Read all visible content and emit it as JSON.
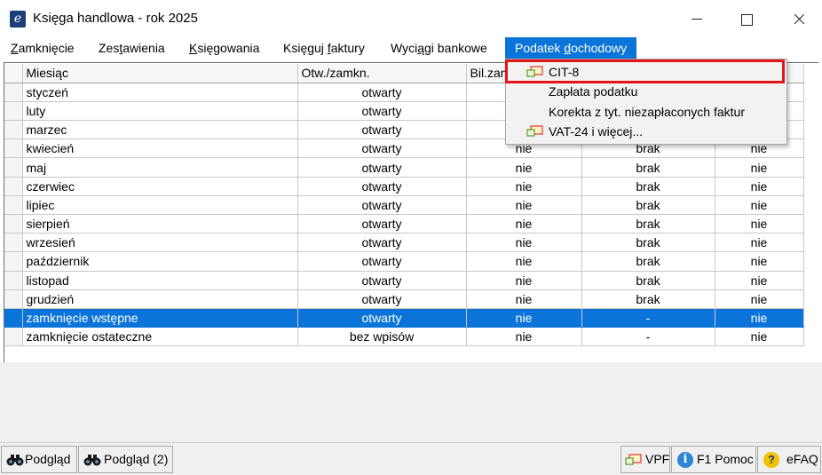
{
  "window": {
    "icon_letter": "e",
    "title": "Księga handlowa - rok 2025"
  },
  "menubar": {
    "items": [
      {
        "label": "Zamknięcie",
        "accel": "Z"
      },
      {
        "label": "Zestawienia",
        "accel": "t"
      },
      {
        "label": "Księgowania",
        "accel": "K"
      },
      {
        "label": "Księguj faktury",
        "accel": "f"
      },
      {
        "label": "Wyciągi bankowe",
        "accel": "ą"
      },
      {
        "label": "Podatek dochodowy",
        "accel": "d",
        "active": true
      }
    ]
  },
  "grid": {
    "columns": [
      "Miesiąc",
      "Otw./zamkn.",
      "Bil.zam",
      "",
      ""
    ],
    "rows": [
      {
        "month": "styczeń",
        "state": "otwarty",
        "c3": "",
        "c4": "",
        "c5": ""
      },
      {
        "month": "luty",
        "state": "otwarty",
        "c3": "",
        "c4": "",
        "c5": ""
      },
      {
        "month": "marzec",
        "state": "otwarty",
        "c3": "",
        "c4": "",
        "c5": ""
      },
      {
        "month": "kwiecień",
        "state": "otwarty",
        "c3": "nie",
        "c4": "brak",
        "c5": "nie"
      },
      {
        "month": "maj",
        "state": "otwarty",
        "c3": "nie",
        "c4": "brak",
        "c5": "nie"
      },
      {
        "month": "czerwiec",
        "state": "otwarty",
        "c3": "nie",
        "c4": "brak",
        "c5": "nie"
      },
      {
        "month": "lipiec",
        "state": "otwarty",
        "c3": "nie",
        "c4": "brak",
        "c5": "nie"
      },
      {
        "month": "sierpień",
        "state": "otwarty",
        "c3": "nie",
        "c4": "brak",
        "c5": "nie"
      },
      {
        "month": "wrzesień",
        "state": "otwarty",
        "c3": "nie",
        "c4": "brak",
        "c5": "nie"
      },
      {
        "month": "październik",
        "state": "otwarty",
        "c3": "nie",
        "c4": "brak",
        "c5": "nie"
      },
      {
        "month": "listopad",
        "state": "otwarty",
        "c3": "nie",
        "c4": "brak",
        "c5": "nie"
      },
      {
        "month": "grudzień",
        "state": "otwarty",
        "c3": "nie",
        "c4": "brak",
        "c5": "nie"
      },
      {
        "month": "zamknięcie wstępne",
        "state": "otwarty",
        "c3": "nie",
        "c4": "-",
        "c5": "nie",
        "selected": true
      },
      {
        "month": "zamknięcie ostateczne",
        "state": "bez wpisów",
        "c3": "nie",
        "c4": "-",
        "c5": "nie"
      }
    ]
  },
  "dropdown": {
    "items": [
      {
        "label": "CIT-8",
        "icon": "form-icon",
        "highlighted": true
      },
      {
        "label": "Zapłata podatku",
        "icon": ""
      },
      {
        "label": "Korekta z tyt. niezapłaconych faktur",
        "icon": ""
      },
      {
        "label": "VAT-24 i więcej...",
        "icon": "form-icon"
      }
    ],
    "highlight_color": "#e3151a"
  },
  "statusbar": {
    "preview_label": "Podgląd",
    "preview2_label": "Podgląd (2)",
    "vpf_label": "VPF",
    "help_label": "F1 Pomoc",
    "efaq_label": "eFAQ"
  },
  "colors": {
    "selection": "#0a74d8",
    "title_icon": "#1c3f79"
  }
}
